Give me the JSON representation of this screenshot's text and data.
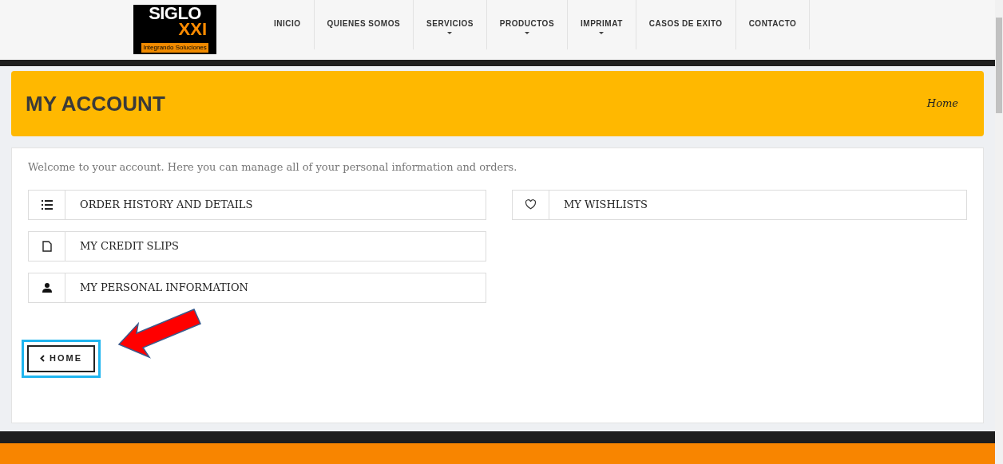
{
  "logo": {
    "line_1": "SIGLO",
    "line_2": "XXI",
    "tagline": "Integrando Soluciones"
  },
  "nav": [
    {
      "label": "INICIO",
      "has_dropdown": false
    },
    {
      "label": "QUIENES SOMOS",
      "has_dropdown": false
    },
    {
      "label": "SERVICIOS",
      "has_dropdown": true
    },
    {
      "label": "PRODUCTOS",
      "has_dropdown": true
    },
    {
      "label": "IMPRIMAT",
      "has_dropdown": true
    },
    {
      "label": "CASOS DE EXITO",
      "has_dropdown": false
    },
    {
      "label": "CONTACTO",
      "has_dropdown": false
    }
  ],
  "banner": {
    "title": "MY ACCOUNT",
    "breadcrumb": "Home"
  },
  "intro": "Welcome to your account. Here you can manage all of your personal information and orders.",
  "links_left": [
    {
      "label": "ORDER HISTORY AND DETAILS",
      "kind": "list"
    },
    {
      "label": "MY CREDIT SLIPS",
      "kind": "document"
    },
    {
      "label": "MY PERSONAL INFORMATION",
      "kind": "user"
    }
  ],
  "links_right": [
    {
      "label": "MY WISHLISTS",
      "kind": "heart"
    }
  ],
  "back_button": {
    "label": "HOME",
    "highlighted": true
  }
}
